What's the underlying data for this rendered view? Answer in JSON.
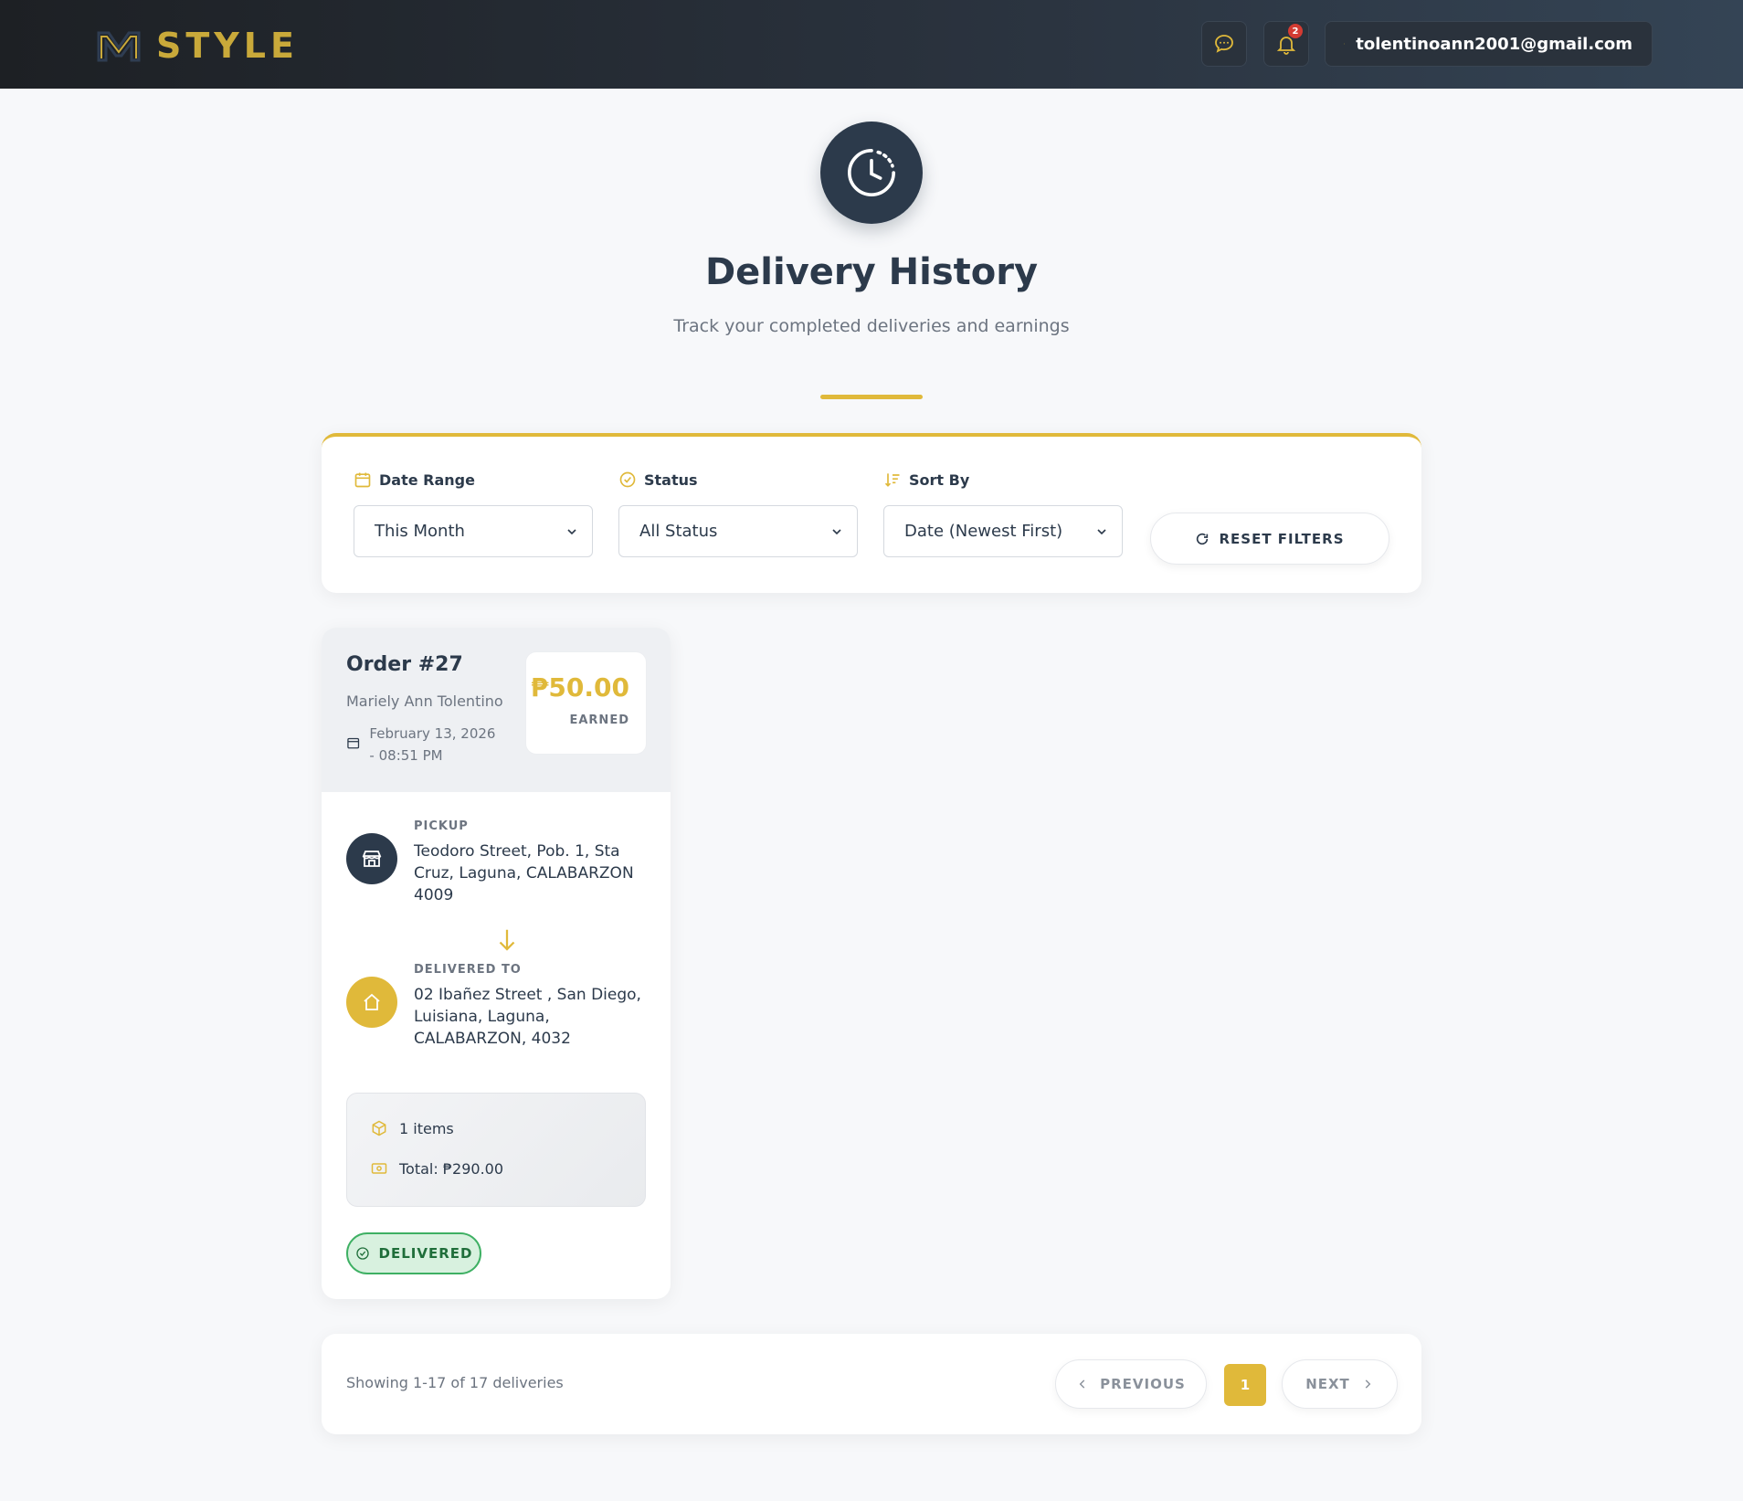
{
  "header": {
    "brand": "STYLE",
    "notification_count": "2",
    "user_email": "tolentinoann2001@gmail.com",
    "accent": "#e0b93a"
  },
  "hero": {
    "title": "Delivery History",
    "subtitle": "Track your completed deliveries and earnings"
  },
  "filters": {
    "date_range": {
      "label": "Date Range",
      "value": "This Month"
    },
    "status": {
      "label": "Status",
      "value": "All Status"
    },
    "sort_by": {
      "label": "Sort By",
      "value": "Date (Newest First)"
    },
    "reset_label": "RESET FILTERS"
  },
  "orders": [
    {
      "title": "Order #27",
      "customer": "Mariely Ann Tolentino",
      "date": "February 13, 2026 - 08:51 PM",
      "earned_amount": "₱50.00",
      "earned_label": "EARNED",
      "pickup_label": "PICKUP",
      "pickup_address": "Teodoro Street, Pob. 1, Sta Cruz, Laguna, CALABARZON 4009",
      "delivered_label": "DELIVERED TO",
      "delivered_address": "02 Ibañez Street , San Diego, Luisiana, Laguna, CALABARZON, 4032",
      "items": "1 items",
      "total": "Total: ₱290.00",
      "status": "DELIVERED",
      "status_color": "#3eb063"
    }
  ],
  "pagination": {
    "info": "Showing 1-17 of 17 deliveries",
    "prev_label": "PREVIOUS",
    "current_page": "1",
    "next_label": "NEXT"
  }
}
